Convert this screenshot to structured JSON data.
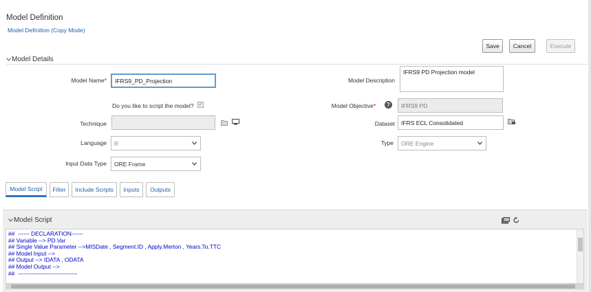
{
  "header": {
    "title": "Model Definition",
    "breadcrumb": "Model Definition (Copy Mode)"
  },
  "toolbar": {
    "save_label": "Save",
    "cancel_label": "Cancel",
    "execute_label": "Execute"
  },
  "model_details": {
    "section_title": "Model Details",
    "model_name_label": "Model Name",
    "model_name_value": "IFRS9_PD_Projection",
    "model_description_label": "Model Description",
    "model_description_value": "IFRS9 PD Projection model",
    "script_question": "Do you like to script the model?",
    "script_checked_mark": "✓",
    "model_objective_label": "Model Objective",
    "model_objective_value": "IFRS9 PD",
    "technique_label": "Technique",
    "technique_value": "",
    "dataset_label": "Dataset",
    "dataset_value": "IFRS ECL Consolidated",
    "language_label": "Language",
    "language_value": "R",
    "type_label": "Type",
    "type_value": "ORE Engine",
    "input_data_type_label": "Input Data Type",
    "input_data_type_value": "ORE Frame",
    "required_mark": "*",
    "help_mark": "?"
  },
  "tabs": [
    {
      "label": "Model Script",
      "active": true
    },
    {
      "label": "Filter",
      "active": false
    },
    {
      "label": "Include Scripts",
      "active": false
    },
    {
      "label": "Inputs",
      "active": false
    },
    {
      "label": "Outputs",
      "active": false
    }
  ],
  "model_script": {
    "section_title": "Model Script",
    "lines": [
      "##  ------ DECLARATION------",
      "## Variable --> PD.Var",
      "## Single Value Parameter -->MISDate , Segment.ID , Apply.Merton , Years.To.TTC",
      "## Model Input -->",
      "## Output --> IDATA , ODATA",
      "## Model Output -->",
      "##  -------------------------------"
    ]
  },
  "icons": {
    "collapse": "chevron-down-icon",
    "help": "help-icon",
    "browse_folder": "folder-icon",
    "view": "monitor-icon",
    "dataset_picker": "folder-grid-icon",
    "script_screen": "screen-icon",
    "reset": "reset-icon"
  },
  "colors": {
    "link": "#1f5fa8",
    "code": "#0000cc",
    "active_tab": "#2f75c0",
    "focus_border": "#5b9bd5",
    "required": "#cc0000"
  }
}
